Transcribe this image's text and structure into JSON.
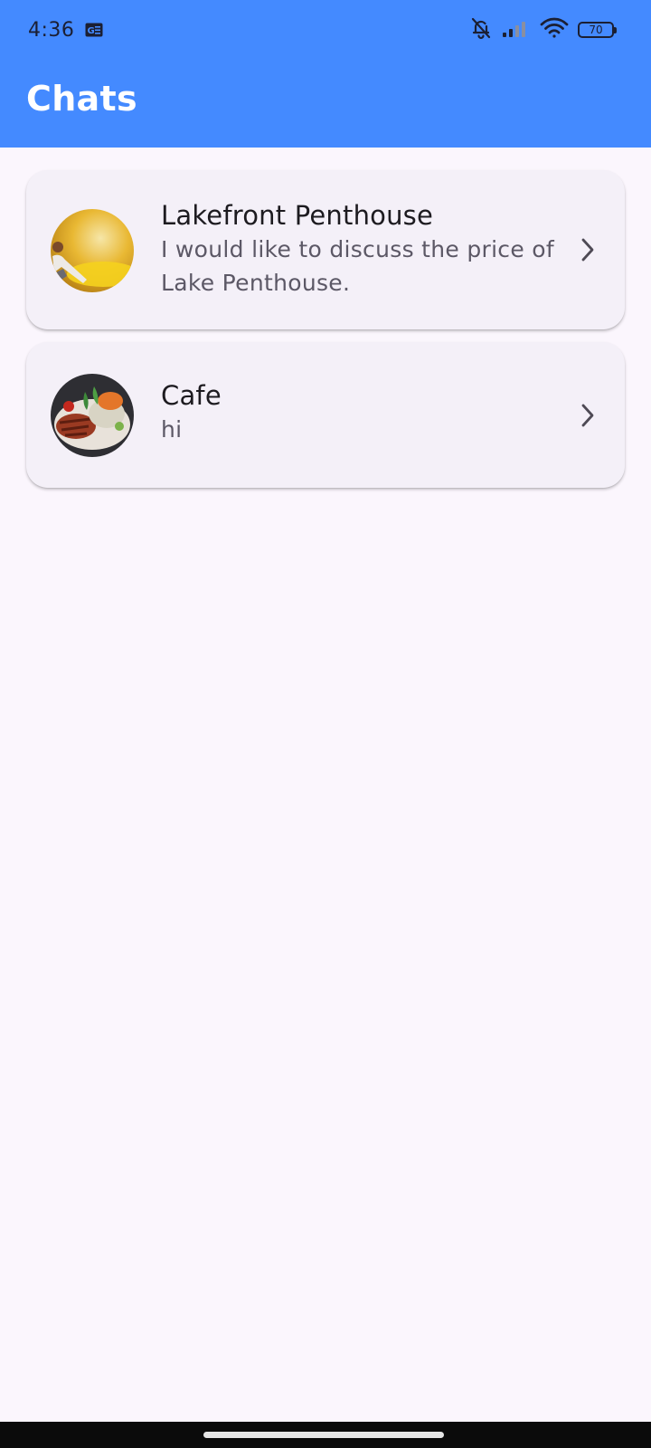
{
  "status_bar": {
    "time": "4:36",
    "notification_icon": "news-app-icon",
    "icons": [
      "muted-bell-icon",
      "signal-icon",
      "wifi-icon",
      "battery-icon"
    ],
    "battery": "70"
  },
  "app_bar": {
    "title": "Chats",
    "color": "#448AFF"
  },
  "chats": [
    {
      "name": "Lakefront Penthouse",
      "preview": "I would like to discuss the price of Lake Penthouse.",
      "avatar": "lakefront-avatar-image",
      "trailing_icon": "chevron-right-icon"
    },
    {
      "name": "Cafe",
      "preview": "hi",
      "avatar": "cafe-avatar-image",
      "trailing_icon": "chevron-right-icon"
    }
  ]
}
